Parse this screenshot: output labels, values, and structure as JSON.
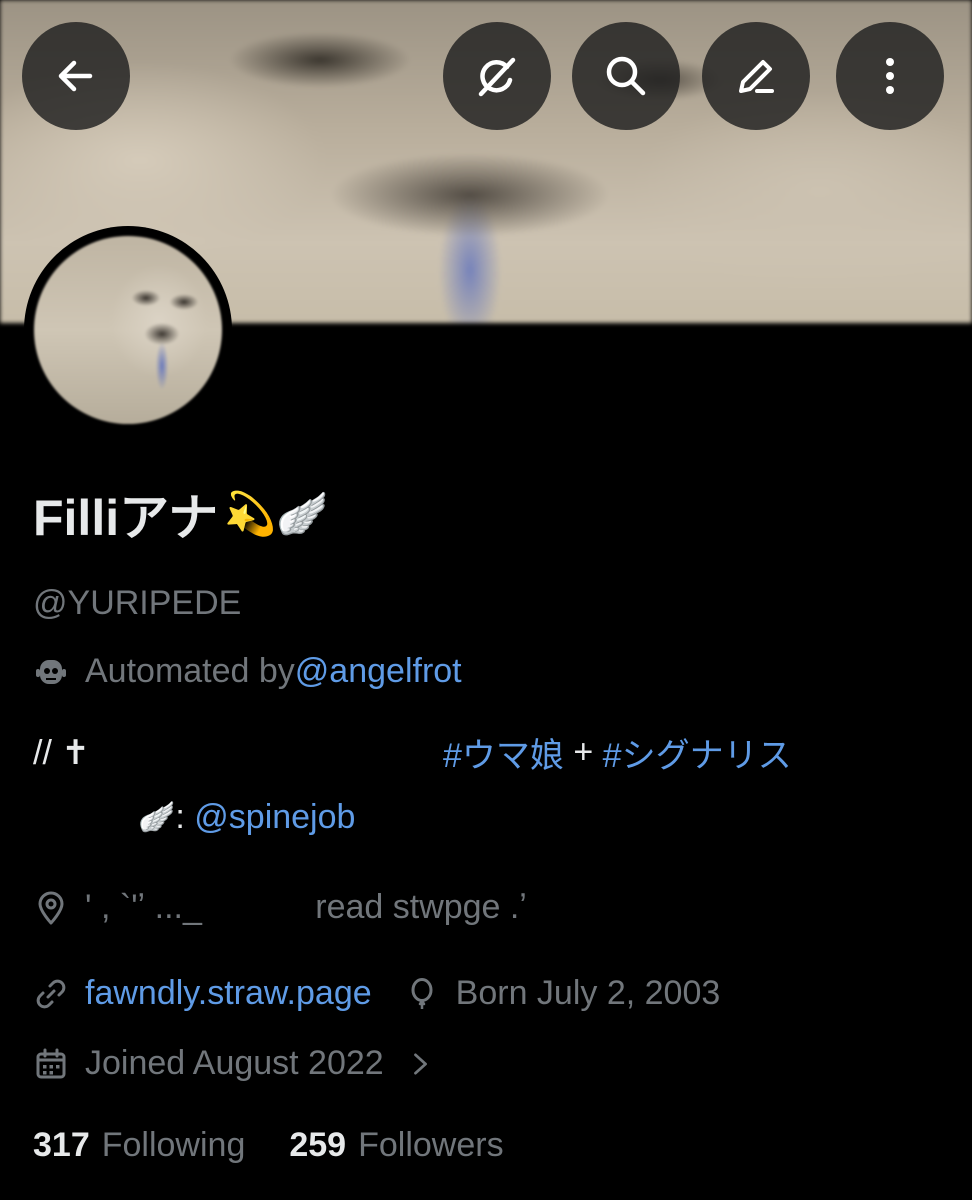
{
  "header": {
    "buttons": [
      {
        "name": "back-button",
        "icon": "arrow-left-icon"
      },
      {
        "name": "grok-button",
        "icon": "grok-icon"
      },
      {
        "name": "search-button",
        "icon": "search-icon"
      },
      {
        "name": "edit-button",
        "icon": "edit-icon"
      },
      {
        "name": "more-button",
        "icon": "more-vertical-icon"
      }
    ]
  },
  "profile": {
    "display_name": "Filliアナ",
    "name_emoji": "💫🪽",
    "handle": "@YURIPEDE",
    "automated_label": "Automated by ",
    "automated_link": "@angelfrot",
    "bio_line1_prefix": "// ✝",
    "bio_tag1": "#ウマ娘",
    "bio_plus": " + ",
    "bio_tag2": "#シグナリス",
    "bio_line2_emoji": "🪽",
    "bio_line2_sep": ": ",
    "bio_line2_link": "@spinejob",
    "location": "' , `'ʼ ..._            read stwpge .ʼ",
    "website": "fawndly.straw.page",
    "birthday": "Born July 2, 2003",
    "joined": "Joined August 2022",
    "following_count": "317",
    "following_label": "Following",
    "followers_count": "259",
    "followers_label": "Followers"
  },
  "colors": {
    "background": "#000000",
    "text_primary": "#e7e9ea",
    "text_secondary": "#71767b",
    "link": "#5f9be6"
  }
}
